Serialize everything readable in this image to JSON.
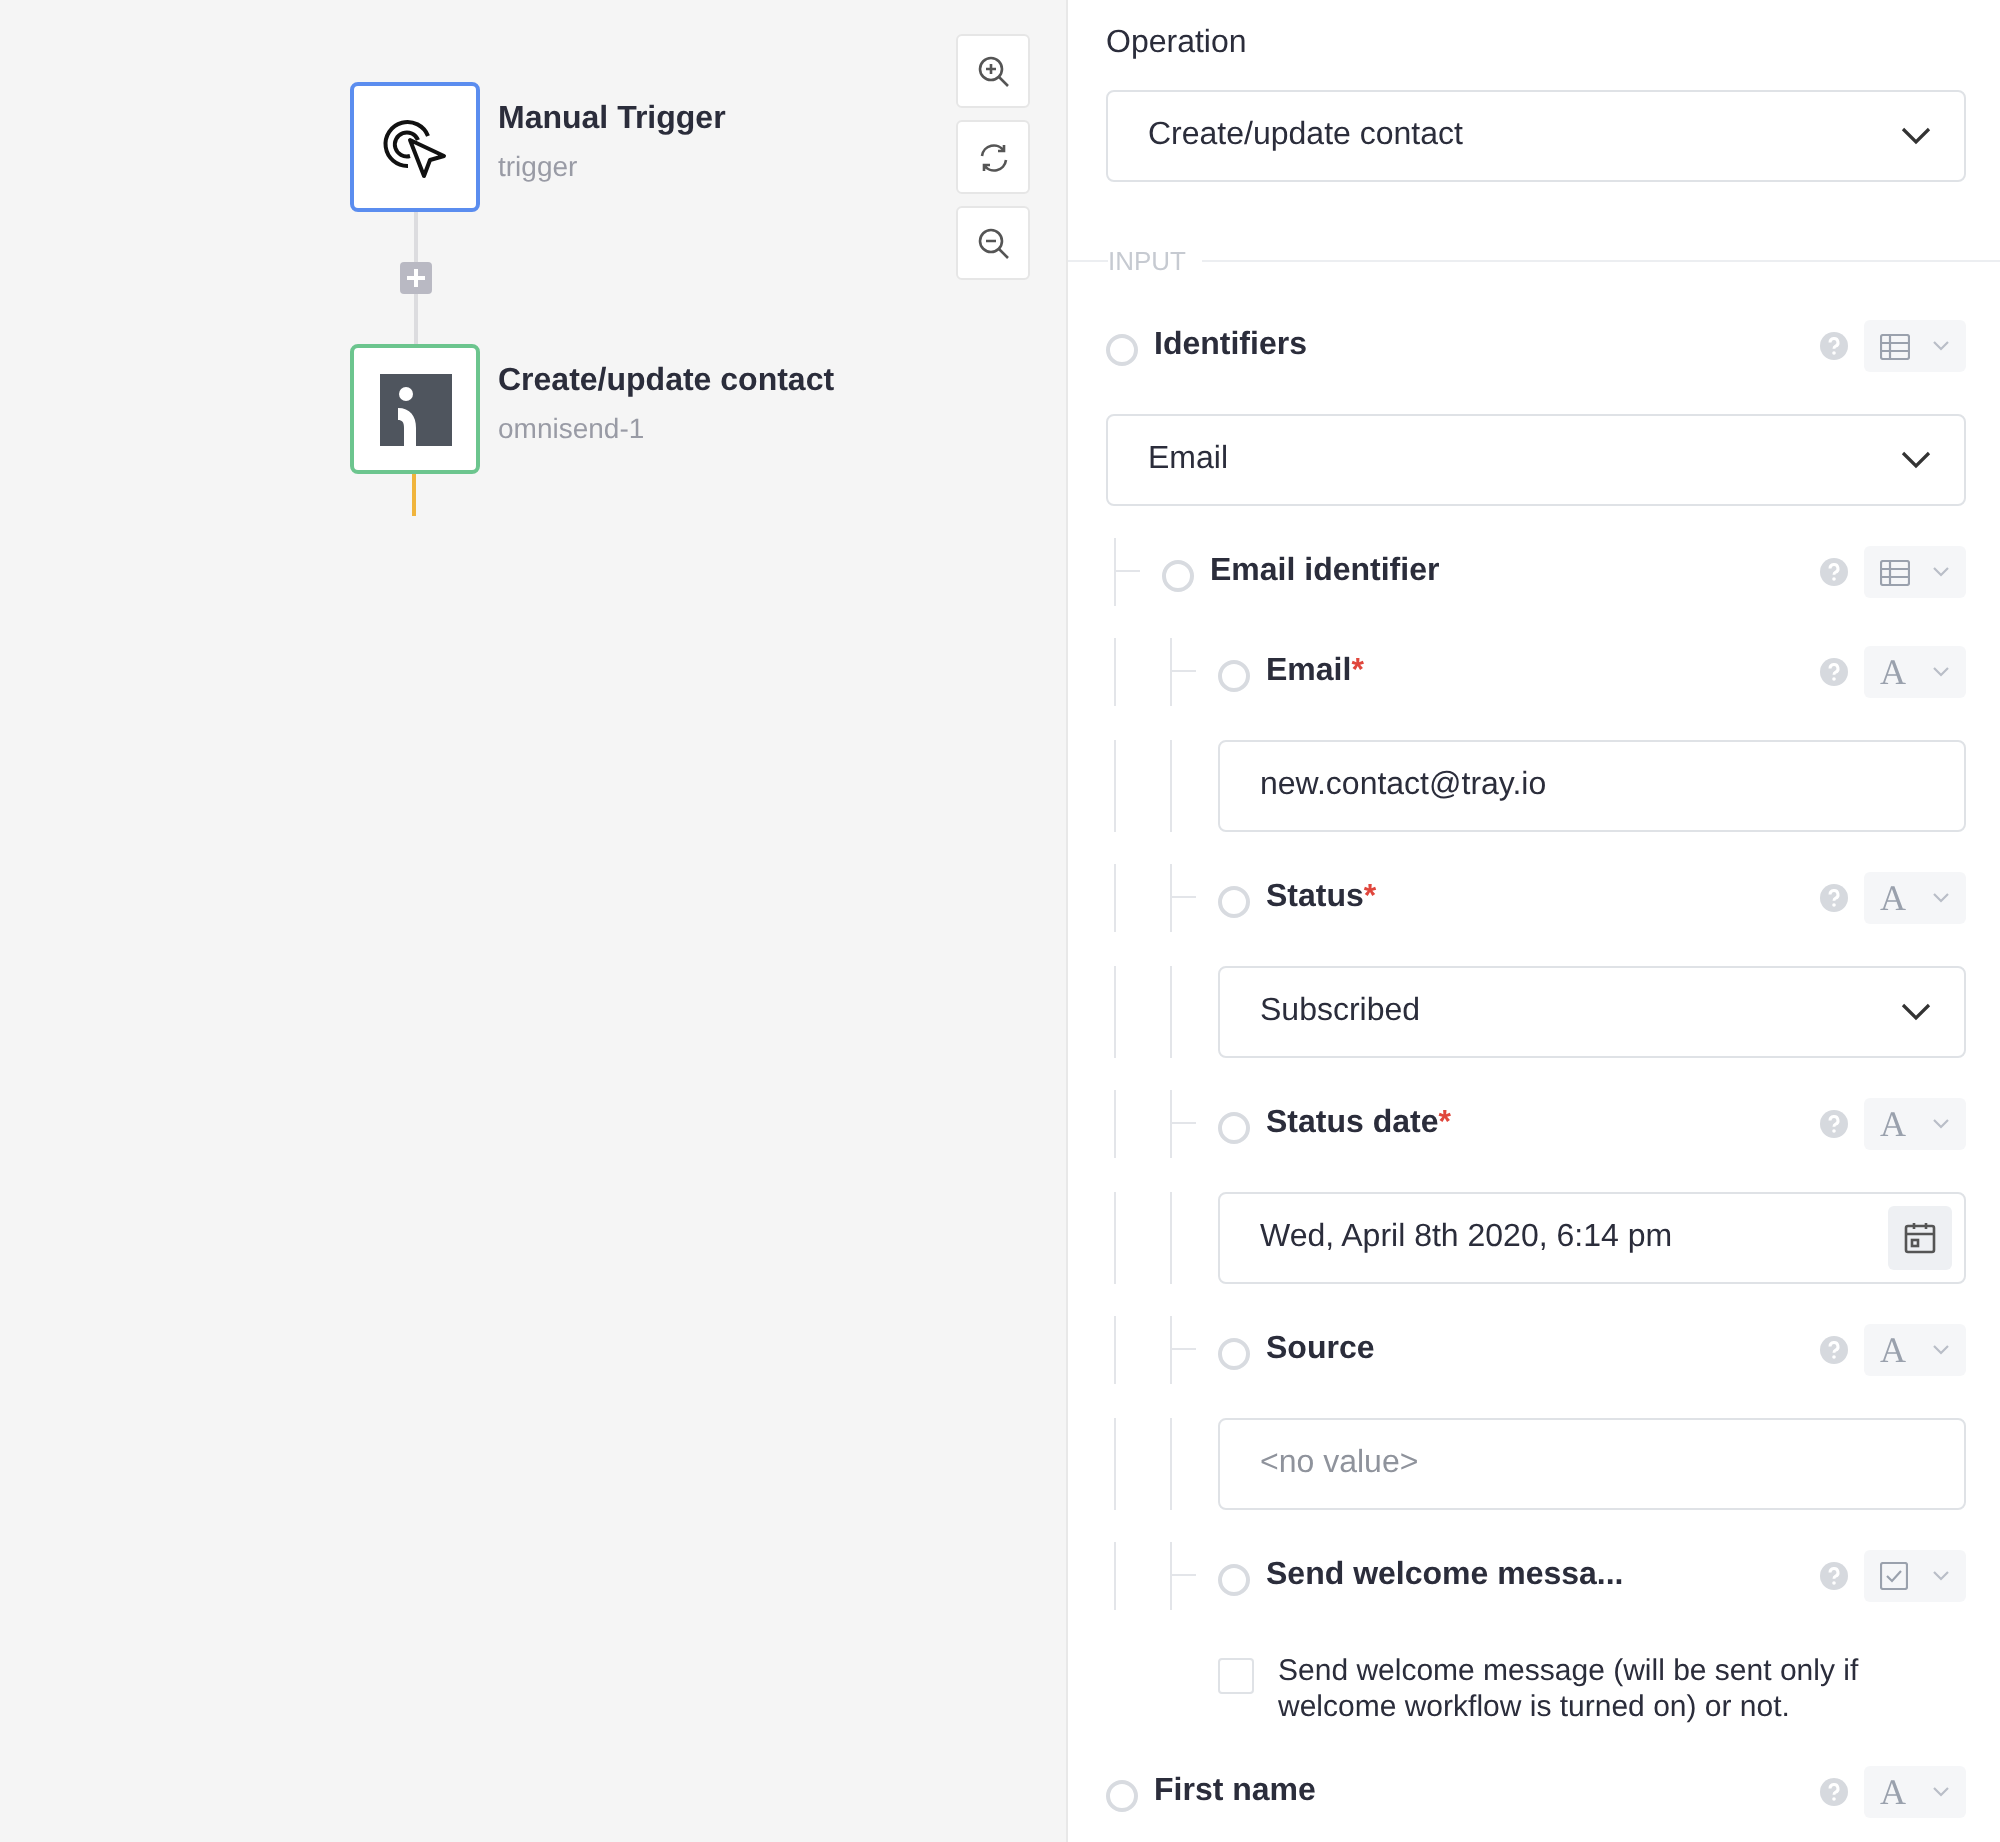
{
  "canvas": {
    "nodes": [
      {
        "title": "Manual Trigger",
        "subtitle": "trigger",
        "kind": "trigger",
        "color": "#5b8def"
      },
      {
        "title": "Create/update contact",
        "subtitle": "omnisend-1",
        "kind": "connector",
        "color": "#6cc58e"
      }
    ]
  },
  "panel": {
    "operation": {
      "label": "Operation",
      "value": "Create/update contact"
    },
    "section_label": "INPUT",
    "fields": [
      {
        "label": "Identifiers",
        "selected": false,
        "type": {
          "kind": "object"
        },
        "input": {
          "kind": "select",
          "value": "Email"
        },
        "children": [
          {
            "label": "Email identifier",
            "selected": false,
            "type": {
              "kind": "object"
            },
            "children": [
              {
                "label": "Email",
                "selected": false,
                "required_mark": "*",
                "type": {
                  "kind": "text",
                  "glyph": "A"
                },
                "input": {
                  "kind": "text",
                  "value": "new.contact@tray.io"
                }
              },
              {
                "label": "Status",
                "selected": false,
                "required_mark": "*",
                "type": {
                  "kind": "text",
                  "glyph": "A"
                },
                "input": {
                  "kind": "select",
                  "value": "Subscribed"
                }
              },
              {
                "label": "Status date",
                "selected": false,
                "required_mark": "*",
                "type": {
                  "kind": "text",
                  "glyph": "A"
                },
                "input": {
                  "kind": "date",
                  "value": "Wed, April 8th 2020, 6:14 pm"
                }
              },
              {
                "label": "Source",
                "selected": false,
                "type": {
                  "kind": "text",
                  "glyph": "A"
                },
                "input": {
                  "kind": "text",
                  "placeholder": "<no value>"
                }
              },
              {
                "label": "Send welcome messa...",
                "selected": false,
                "type": {
                  "kind": "boolean"
                },
                "input": {
                  "kind": "checkbox",
                  "checked": false,
                  "description": "Send welcome message (will be sent only if welcome workflow is turned on) or not."
                }
              }
            ]
          }
        ]
      },
      {
        "label": "First name",
        "selected": false,
        "type": {
          "kind": "text",
          "glyph": "A"
        }
      }
    ]
  }
}
